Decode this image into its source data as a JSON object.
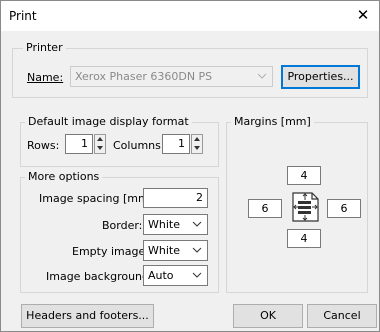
{
  "window": {
    "title": "Print",
    "close_glyph": "✕"
  },
  "printer": {
    "group_label": "Printer",
    "name_label": "Name:",
    "selected": "Xerox Phaser 6360DN PS",
    "properties_label": "Properties..."
  },
  "display_format": {
    "group_label": "Default image display format",
    "rows_label": "Rows:",
    "rows_value": "1",
    "columns_label": "Columns:",
    "columns_value": "1"
  },
  "more_options": {
    "group_label": "More options",
    "spacing_label": "Image spacing [mm]:",
    "spacing_value": "2",
    "border_label": "Border:",
    "border_value": "White",
    "empty_label": "Empty image:",
    "empty_value": "White",
    "background_label": "Image background:",
    "background_value": "Auto"
  },
  "margins": {
    "group_label": "Margins [mm]",
    "top": "4",
    "left": "6",
    "right": "6",
    "bottom": "4"
  },
  "footer": {
    "headers_label": "Headers and footers...",
    "ok_label": "OK",
    "cancel_label": "Cancel"
  },
  "colors": {
    "accent": "#0078d7",
    "dialog_bg": "#f0f0f0"
  }
}
